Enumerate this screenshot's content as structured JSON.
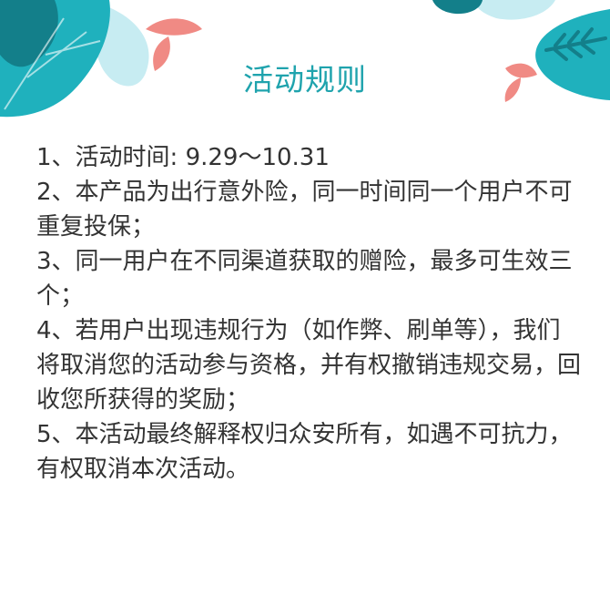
{
  "page": {
    "title": "活动规则"
  },
  "rules": [
    "1、活动时间: 9.29～10.31",
    "2、本产品为出行意外险，同一时间同一个用户不可重复投保；",
    "3、同一用户在不同渠道获取的赠险，最多可生效三个；",
    "4、若用户出现违规行为（如作弊、刷单等），我们将取消您的活动参与资格，并有权撤销违规交易，回收您所获得的奖励；",
    "5、本活动最终解释权归众安所有，如遇不可抗力，有权取消本次活动。"
  ],
  "colors": {
    "title": "#1fa3ad",
    "text": "#333333",
    "leaf_teal": "#1fb1bd",
    "leaf_dark": "#137f8a",
    "leaf_light": "#bfe9f0",
    "leaf_coral": "#f08a84"
  },
  "decorations": {
    "left": "tropical-leaves-icon",
    "right": "tropical-leaves-icon"
  }
}
